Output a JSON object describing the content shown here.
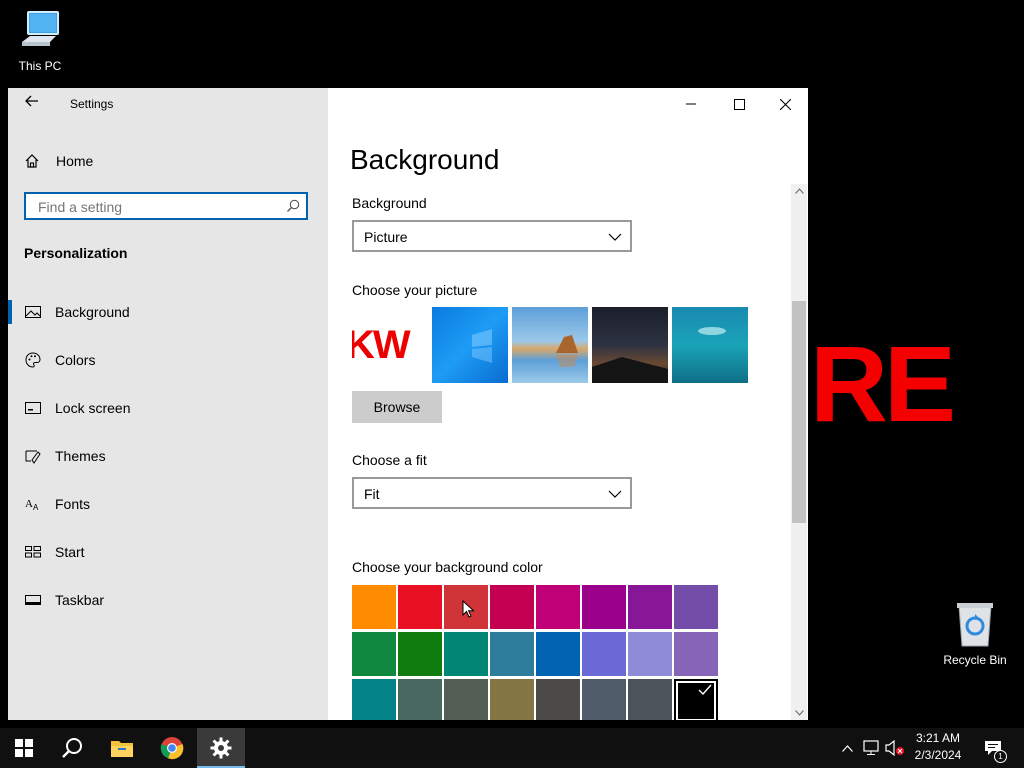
{
  "desktop": {
    "this_pc_label": "This PC",
    "recycle_bin_label": "Recycle Bin",
    "wallpaper_text": "RE"
  },
  "window": {
    "app_title": "Settings",
    "back_icon": "back-arrow-icon",
    "controls": [
      "minimize",
      "maximize",
      "close"
    ]
  },
  "sidebar": {
    "home_label": "Home",
    "search_placeholder": "Find a setting",
    "section_title": "Personalization",
    "items": [
      {
        "label": "Background",
        "icon": "picture-icon",
        "active": true
      },
      {
        "label": "Colors",
        "icon": "palette-icon",
        "active": false
      },
      {
        "label": "Lock screen",
        "icon": "lock-screen-icon",
        "active": false
      },
      {
        "label": "Themes",
        "icon": "themes-icon",
        "active": false
      },
      {
        "label": "Fonts",
        "icon": "fonts-icon",
        "active": false
      },
      {
        "label": "Start",
        "icon": "start-icon",
        "active": false
      },
      {
        "label": "Taskbar",
        "icon": "taskbar-icon",
        "active": false
      }
    ]
  },
  "main": {
    "page_title": "Background",
    "background_label": "Background",
    "background_value": "Picture",
    "choose_picture_label": "Choose your picture",
    "thumb_text": "KW",
    "browse_label": "Browse",
    "fit_label": "Choose a fit",
    "fit_value": "Fit",
    "color_label": "Choose your background color",
    "colors": [
      [
        "#ff8c00",
        "#e81123",
        "#d13438",
        "#c30052",
        "#bf0077",
        "#9a0089",
        "#881798",
        "#744da9"
      ],
      [
        "#10893e",
        "#107c10",
        "#018574",
        "#2d7d9a",
        "#0063b1",
        "#6b69d6",
        "#8e8cd8",
        "#8764b8"
      ],
      [
        "#038387",
        "#486860",
        "#525e54",
        "#847545",
        "#4c4a48",
        "#515c6b",
        "#4a5459",
        "#000000"
      ]
    ],
    "selected_color": "#000000"
  },
  "taskbar": {
    "pinned": [
      "start-icon",
      "search-icon",
      "file-explorer-icon",
      "chrome-icon",
      "settings-icon"
    ],
    "time": "3:21 AM",
    "date": "2/3/2024",
    "notification_count": "1"
  }
}
